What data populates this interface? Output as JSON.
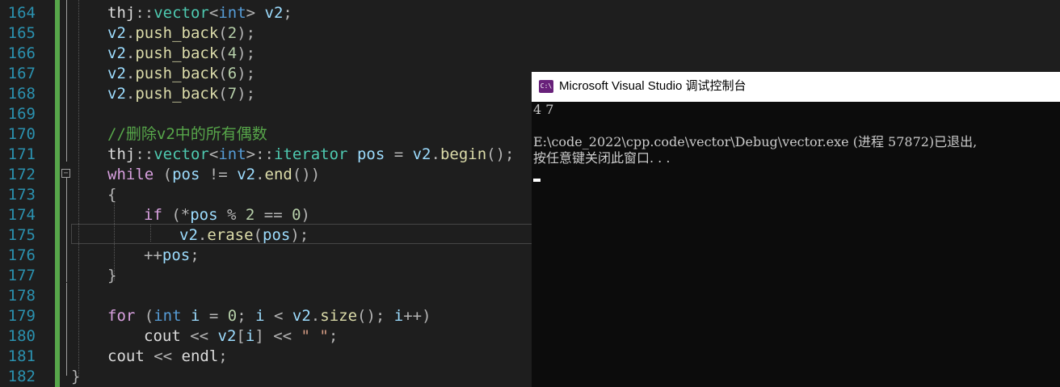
{
  "editor": {
    "lines": [
      {
        "num": "164",
        "tokens": [
          {
            "t": "thj",
            "c": "ns"
          },
          {
            "t": "::",
            "c": "op"
          },
          {
            "t": "vector",
            "c": "ty"
          },
          {
            "t": "<",
            "c": "op"
          },
          {
            "t": "int",
            "c": "kw"
          },
          {
            "t": "> ",
            "c": "op"
          },
          {
            "t": "v2",
            "c": "var"
          },
          {
            "t": ";",
            "c": "op"
          }
        ]
      },
      {
        "num": "165",
        "tokens": [
          {
            "t": "v2",
            "c": "var"
          },
          {
            "t": ".",
            "c": "op"
          },
          {
            "t": "push_back",
            "c": "fn"
          },
          {
            "t": "(",
            "c": "op"
          },
          {
            "t": "2",
            "c": "num"
          },
          {
            "t": ");",
            "c": "op"
          }
        ]
      },
      {
        "num": "166",
        "tokens": [
          {
            "t": "v2",
            "c": "var"
          },
          {
            "t": ".",
            "c": "op"
          },
          {
            "t": "push_back",
            "c": "fn"
          },
          {
            "t": "(",
            "c": "op"
          },
          {
            "t": "4",
            "c": "num"
          },
          {
            "t": ");",
            "c": "op"
          }
        ]
      },
      {
        "num": "167",
        "tokens": [
          {
            "t": "v2",
            "c": "var"
          },
          {
            "t": ".",
            "c": "op"
          },
          {
            "t": "push_back",
            "c": "fn"
          },
          {
            "t": "(",
            "c": "op"
          },
          {
            "t": "6",
            "c": "num"
          },
          {
            "t": ");",
            "c": "op"
          }
        ]
      },
      {
        "num": "168",
        "tokens": [
          {
            "t": "v2",
            "c": "var"
          },
          {
            "t": ".",
            "c": "op"
          },
          {
            "t": "push_back",
            "c": "fn"
          },
          {
            "t": "(",
            "c": "op"
          },
          {
            "t": "7",
            "c": "num"
          },
          {
            "t": ");",
            "c": "op"
          }
        ]
      },
      {
        "num": "169",
        "tokens": []
      },
      {
        "num": "170",
        "tokens": [
          {
            "t": "//删除v2中的所有偶数",
            "c": "cmt"
          }
        ]
      },
      {
        "num": "171",
        "tokens": [
          {
            "t": "thj",
            "c": "ns"
          },
          {
            "t": "::",
            "c": "op"
          },
          {
            "t": "vector",
            "c": "ty"
          },
          {
            "t": "<",
            "c": "op"
          },
          {
            "t": "int",
            "c": "kw"
          },
          {
            "t": ">::",
            "c": "op"
          },
          {
            "t": "iterator",
            "c": "ty"
          },
          {
            "t": " ",
            "c": "op"
          },
          {
            "t": "pos",
            "c": "var"
          },
          {
            "t": " = ",
            "c": "op"
          },
          {
            "t": "v2",
            "c": "var"
          },
          {
            "t": ".",
            "c": "op"
          },
          {
            "t": "begin",
            "c": "fn"
          },
          {
            "t": "();",
            "c": "op"
          }
        ]
      },
      {
        "num": "172",
        "tokens": [
          {
            "t": "while",
            "c": "ctl"
          },
          {
            "t": " (",
            "c": "op"
          },
          {
            "t": "pos",
            "c": "var"
          },
          {
            "t": " != ",
            "c": "op"
          },
          {
            "t": "v2",
            "c": "var"
          },
          {
            "t": ".",
            "c": "op"
          },
          {
            "t": "end",
            "c": "fn"
          },
          {
            "t": "())",
            "c": "op"
          }
        ]
      },
      {
        "num": "173",
        "tokens": [
          {
            "t": "{",
            "c": "op"
          }
        ]
      },
      {
        "num": "174",
        "tokens": [
          {
            "t": "if",
            "c": "ctl"
          },
          {
            "t": " (*",
            "c": "op"
          },
          {
            "t": "pos",
            "c": "var"
          },
          {
            "t": " % ",
            "c": "op"
          },
          {
            "t": "2",
            "c": "num"
          },
          {
            "t": " == ",
            "c": "op"
          },
          {
            "t": "0",
            "c": "num"
          },
          {
            "t": ")",
            "c": "op"
          }
        ]
      },
      {
        "num": "175",
        "tokens": [
          {
            "t": "v2",
            "c": "var"
          },
          {
            "t": ".",
            "c": "op"
          },
          {
            "t": "erase",
            "c": "fn"
          },
          {
            "t": "(",
            "c": "op"
          },
          {
            "t": "pos",
            "c": "var"
          },
          {
            "t": ");",
            "c": "op"
          }
        ]
      },
      {
        "num": "176",
        "tokens": [
          {
            "t": "++",
            "c": "op"
          },
          {
            "t": "pos",
            "c": "var"
          },
          {
            "t": ";",
            "c": "op"
          }
        ]
      },
      {
        "num": "177",
        "tokens": [
          {
            "t": "}",
            "c": "op"
          }
        ]
      },
      {
        "num": "178",
        "tokens": []
      },
      {
        "num": "179",
        "tokens": [
          {
            "t": "for",
            "c": "ctl"
          },
          {
            "t": " (",
            "c": "op"
          },
          {
            "t": "int",
            "c": "kw"
          },
          {
            "t": " ",
            "c": "op"
          },
          {
            "t": "i",
            "c": "var"
          },
          {
            "t": " = ",
            "c": "op"
          },
          {
            "t": "0",
            "c": "num"
          },
          {
            "t": "; ",
            "c": "op"
          },
          {
            "t": "i",
            "c": "var"
          },
          {
            "t": " < ",
            "c": "op"
          },
          {
            "t": "v2",
            "c": "var"
          },
          {
            "t": ".",
            "c": "op"
          },
          {
            "t": "size",
            "c": "fn"
          },
          {
            "t": "(); ",
            "c": "op"
          },
          {
            "t": "i",
            "c": "var"
          },
          {
            "t": "++)",
            "c": "op"
          }
        ]
      },
      {
        "num": "180",
        "tokens": [
          {
            "t": "cout",
            "c": "ns"
          },
          {
            "t": " << ",
            "c": "op"
          },
          {
            "t": "v2",
            "c": "var"
          },
          {
            "t": "[",
            "c": "op"
          },
          {
            "t": "i",
            "c": "var"
          },
          {
            "t": "] << ",
            "c": "op"
          },
          {
            "t": "\" \"",
            "c": "str"
          },
          {
            "t": ";",
            "c": "op"
          }
        ]
      },
      {
        "num": "181",
        "tokens": [
          {
            "t": "cout",
            "c": "ns"
          },
          {
            "t": " << ",
            "c": "op"
          },
          {
            "t": "endl",
            "c": "ns"
          },
          {
            "t": ";",
            "c": "op"
          }
        ]
      },
      {
        "num": "182",
        "tokens": [
          {
            "t": "}",
            "c": "op"
          }
        ]
      }
    ],
    "fold_symbol": "−"
  },
  "console": {
    "icon_text": "C:\\",
    "title": "Microsoft Visual Studio 调试控制台",
    "lines": [
      "4 7",
      "",
      "E:\\code_2022\\cpp.code\\vector\\Debug\\vector.exe (进程 57872)已退出,",
      "按任意键关闭此窗口. . ."
    ]
  },
  "colors": {
    "editor_bg": "#1e1e1e",
    "console_bg": "#0c0c0c",
    "line_number": "#2b91af",
    "change_bar": "#57a64a"
  }
}
